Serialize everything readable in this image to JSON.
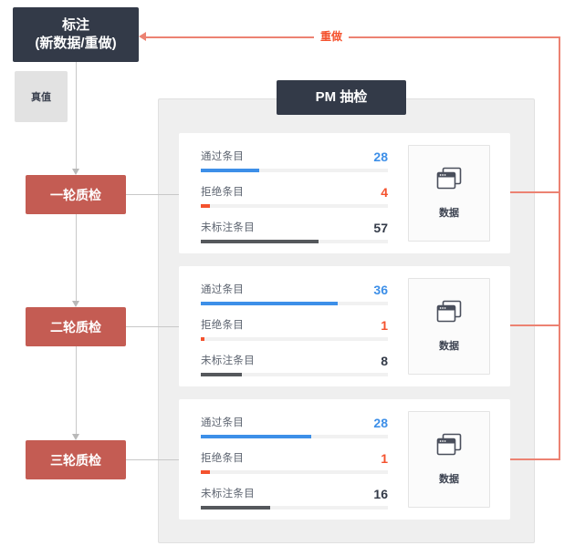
{
  "flow": {
    "annotate_node": {
      "line1": "标注",
      "line2": "(新数据/重做)"
    },
    "truth_node": {
      "label": "真值"
    },
    "qc_nodes": [
      {
        "label": "一轮质检"
      },
      {
        "label": "二轮质检"
      },
      {
        "label": "三轮质检"
      }
    ],
    "redo_label": "重做"
  },
  "panel": {
    "header": "PM 抽检",
    "cards": [
      {
        "metrics": [
          {
            "label": "通过条目",
            "value": "28",
            "kind": "pass",
            "pct": 31
          },
          {
            "label": "拒绝条目",
            "value": "4",
            "kind": "reject",
            "pct": 5
          },
          {
            "label": "未标注条目",
            "value": "57",
            "kind": "unlabeled",
            "pct": 63
          }
        ],
        "tile": {
          "icon": "windows-stack-icon",
          "label": "数据"
        }
      },
      {
        "metrics": [
          {
            "label": "通过条目",
            "value": "36",
            "kind": "pass",
            "pct": 73
          },
          {
            "label": "拒绝条目",
            "value": "1",
            "kind": "reject",
            "pct": 2
          },
          {
            "label": "未标注条目",
            "value": "8",
            "kind": "unlabeled",
            "pct": 22
          }
        ],
        "tile": {
          "icon": "windows-stack-icon",
          "label": "数据"
        }
      },
      {
        "metrics": [
          {
            "label": "通过条目",
            "value": "28",
            "kind": "pass",
            "pct": 59
          },
          {
            "label": "拒绝条目",
            "value": "1",
            "kind": "reject",
            "pct": 5
          },
          {
            "label": "未标注条目",
            "value": "16",
            "kind": "unlabeled",
            "pct": 37
          }
        ],
        "tile": {
          "icon": "windows-stack-icon",
          "label": "数据"
        }
      }
    ]
  },
  "colors": {
    "dark": "#333a48",
    "red_node": "#c45c53",
    "pass": "#3d8fe8",
    "reject": "#f4522e",
    "unlabeled": "#55585c",
    "redo_line": "#ec8272",
    "panel_bg": "#efefef",
    "truth_bg": "#e2e2e2"
  }
}
